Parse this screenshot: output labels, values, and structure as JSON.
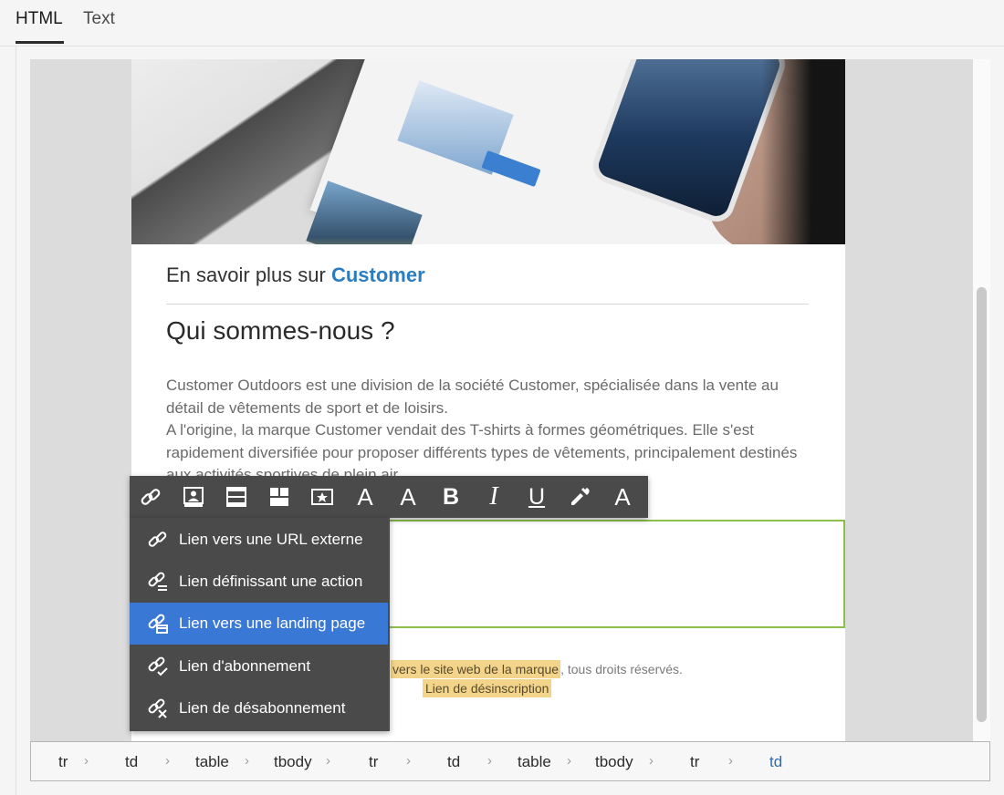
{
  "tabs": [
    {
      "label": "HTML",
      "active": true
    },
    {
      "label": "Text",
      "active": false
    }
  ],
  "email": {
    "learn_prefix": "En savoir plus sur ",
    "learn_brand": "Customer",
    "about_title": "Qui sommes-nous ?",
    "about_para1": "Customer Outdoors est une division de la société Customer, spécialisée dans la vente au détail de vêtements de sport et de loisirs.",
    "about_para2": "A l'origine, la marque Customer vendait des T-shirts à formes géométriques. Elle s'est rapidement diversifiée pour proposer différents types de vêtements, principalement destinés aux activités sportives de plein air.",
    "footer_link": "vers le site web de la marque",
    "footer_suffix": ", tous droits réservés.",
    "footer_unsubscribe": "Lien de désinscription"
  },
  "toolbar": {
    "tools": [
      "link-icon",
      "personalization-icon",
      "content-block-icon",
      "dynamic-content-icon",
      "embedded-image-icon",
      "font-color-icon",
      "background-color-icon",
      "bold-icon",
      "italic-icon",
      "underline-icon",
      "eyedropper-icon",
      "clear-format-icon"
    ],
    "bold_glyph": "B",
    "italic_glyph": "I",
    "underline_glyph": "U",
    "font_glyph": "A"
  },
  "link_menu": {
    "items": [
      {
        "label": "Lien vers une URL externe",
        "icon": "link-external-icon",
        "selected": false
      },
      {
        "label": "Lien définissant une action",
        "icon": "link-action-icon",
        "selected": false
      },
      {
        "label": "Lien vers une landing page",
        "icon": "link-landing-page-icon",
        "selected": true
      },
      {
        "label": "Lien d'abonnement",
        "icon": "link-subscribe-icon",
        "selected": false
      },
      {
        "label": "Lien de désabonnement",
        "icon": "link-unsubscribe-icon",
        "selected": false
      }
    ]
  },
  "breadcrumb": {
    "items": [
      "tr",
      "td",
      "table",
      "tbody",
      "tr",
      "td",
      "table",
      "tbody",
      "tr",
      "td"
    ]
  },
  "colors": {
    "accent": "#3a78d6",
    "brand_blue": "#2b7dc0",
    "selection_border": "#8cc04b",
    "highlight": "#f2d48a",
    "toolbar_bg": "#4a4a4a"
  }
}
